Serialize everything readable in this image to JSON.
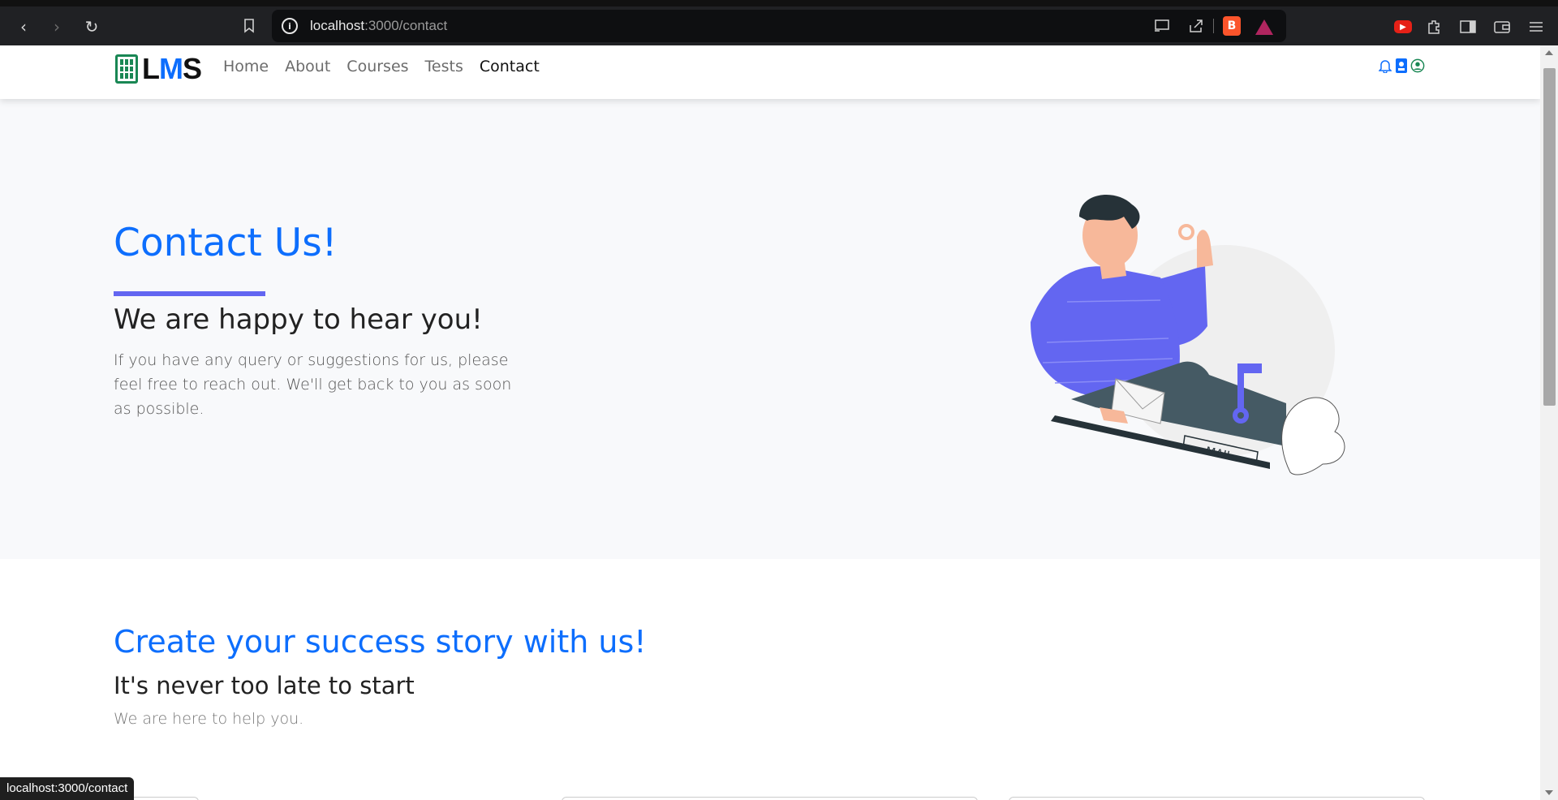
{
  "browser": {
    "url_host": "localhost",
    "url_path": ":3000/contact",
    "status_url": "localhost:3000/contact"
  },
  "nav": {
    "brand_l": "L",
    "brand_m": "M",
    "brand_s": "S",
    "links": [
      "Home",
      "About",
      "Courses",
      "Tests",
      "Contact"
    ],
    "active": "Contact"
  },
  "hero": {
    "title": "Contact Us!",
    "subtitle": "We are happy to hear you!",
    "body": "If you have any query or suggestions for us, please feel free to reach out. We'll get back to you as soon as possible.",
    "mailbox_label": "MAIL"
  },
  "section2": {
    "title": "Create your success story with us!",
    "subtitle": "It's never too late to start",
    "body": "We are here to help you."
  },
  "colors": {
    "primary": "#0d6efd",
    "accent": "#6366f1",
    "brand_icon": "#198754"
  },
  "icons": [
    "back-icon",
    "forward-icon",
    "reload-icon",
    "bookmark-icon",
    "info-icon",
    "cast-icon",
    "share-icon",
    "brave-shield-icon",
    "brave-rewards-icon",
    "youtube-icon",
    "extensions-icon",
    "sidebar-icon",
    "wallet-icon",
    "menu-icon",
    "bell-icon",
    "id-card-icon",
    "user-circle-icon"
  ]
}
